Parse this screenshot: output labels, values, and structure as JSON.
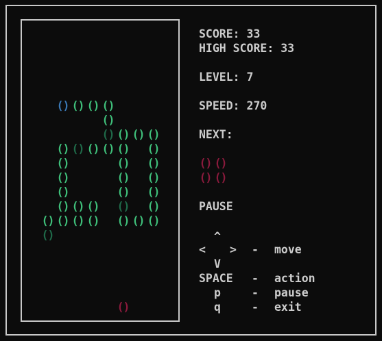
{
  "hud": {
    "score_label": "SCORE:",
    "score": "33",
    "high_score_label": "HIGH SCORE:",
    "high_score": "33",
    "level_label": "LEVEL:",
    "level": "7",
    "speed_label": "SPEED:",
    "speed": "270",
    "next_label": "NEXT:",
    "status": "PAUSE"
  },
  "controls": {
    "up_arrow": "^",
    "left_arrow": "<",
    "right_arrow": ">",
    "down_arrow": "V",
    "dash": "-",
    "move_label": "move",
    "space_key": "SPACE",
    "action_label": "action",
    "pause_key": "p",
    "pause_label": "pause",
    "quit_key": "q",
    "exit_label": "exit"
  },
  "block_glyph": "()",
  "colors": {
    "settled": "#3fbf7a",
    "settled_dark": "#1f6a49",
    "blue": "#3a78b4",
    "active_piece": "#8a1a3c",
    "next_piece": "#8a1a3c",
    "text": "#cccccc",
    "frame": "#c8c8c8",
    "background": "#0c0c0c"
  },
  "board": {
    "columns": 10,
    "rows": 20,
    "cells": [
      {
        "row": 2,
        "col": 1,
        "color": "blue"
      },
      {
        "row": 2,
        "col": 2,
        "color": "settled"
      },
      {
        "row": 2,
        "col": 3,
        "color": "settled"
      },
      {
        "row": 2,
        "col": 4,
        "color": "settled"
      },
      {
        "row": 3,
        "col": 4,
        "color": "settled"
      },
      {
        "row": 4,
        "col": 4,
        "color": "settled_dark"
      },
      {
        "row": 4,
        "col": 5,
        "color": "settled"
      },
      {
        "row": 4,
        "col": 6,
        "color": "settled"
      },
      {
        "row": 4,
        "col": 7,
        "color": "settled"
      },
      {
        "row": 5,
        "col": 1,
        "color": "settled"
      },
      {
        "row": 5,
        "col": 2,
        "color": "settled_dark"
      },
      {
        "row": 5,
        "col": 3,
        "color": "settled"
      },
      {
        "row": 5,
        "col": 4,
        "color": "settled"
      },
      {
        "row": 5,
        "col": 5,
        "color": "settled"
      },
      {
        "row": 5,
        "col": 7,
        "color": "settled"
      },
      {
        "row": 6,
        "col": 1,
        "color": "settled"
      },
      {
        "row": 6,
        "col": 5,
        "color": "settled"
      },
      {
        "row": 6,
        "col": 7,
        "color": "settled"
      },
      {
        "row": 7,
        "col": 1,
        "color": "settled"
      },
      {
        "row": 7,
        "col": 5,
        "color": "settled"
      },
      {
        "row": 7,
        "col": 7,
        "color": "settled"
      },
      {
        "row": 8,
        "col": 1,
        "color": "settled"
      },
      {
        "row": 8,
        "col": 5,
        "color": "settled"
      },
      {
        "row": 8,
        "col": 7,
        "color": "settled"
      },
      {
        "row": 9,
        "col": 1,
        "color": "settled"
      },
      {
        "row": 9,
        "col": 2,
        "color": "settled"
      },
      {
        "row": 9,
        "col": 3,
        "color": "settled"
      },
      {
        "row": 9,
        "col": 5,
        "color": "settled_dark"
      },
      {
        "row": 9,
        "col": 7,
        "color": "settled"
      },
      {
        "row": 10,
        "col": 0,
        "color": "settled"
      },
      {
        "row": 10,
        "col": 1,
        "color": "settled"
      },
      {
        "row": 10,
        "col": 2,
        "color": "settled"
      },
      {
        "row": 10,
        "col": 3,
        "color": "settled"
      },
      {
        "row": 10,
        "col": 5,
        "color": "settled"
      },
      {
        "row": 10,
        "col": 6,
        "color": "settled"
      },
      {
        "row": 10,
        "col": 7,
        "color": "settled"
      },
      {
        "row": 11,
        "col": 0,
        "color": "settled_dark"
      },
      {
        "row": 16,
        "col": 5,
        "color": "active_piece"
      }
    ]
  },
  "next_piece": {
    "cells": [
      {
        "row": 0,
        "col": 0
      },
      {
        "row": 0,
        "col": 1
      },
      {
        "row": 1,
        "col": 0
      },
      {
        "row": 1,
        "col": 1
      }
    ]
  }
}
